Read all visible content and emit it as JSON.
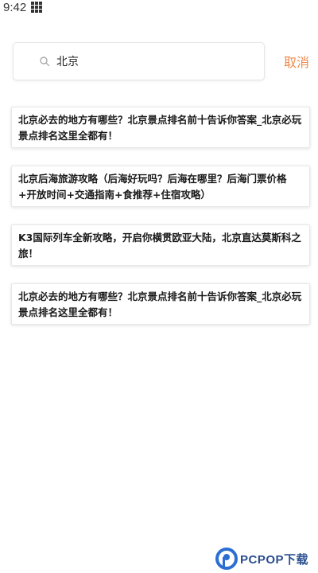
{
  "status_bar": {
    "time": "9:42",
    "icon": "app-grid-icon"
  },
  "search": {
    "query": "北京",
    "icon": "search-icon",
    "cancel_label": "取消"
  },
  "colors": {
    "accent": "#f08a4b",
    "watermark": "#2b4f8f"
  },
  "results": [
    {
      "title": "北京必去的地方有哪些？北京景点排名前十告诉你答案_北京必玩景点排名这里全都有！"
    },
    {
      "title": "北京后海旅游攻略（后海好玩吗？后海在哪里？后海门票价格+开放时间+交通指南+食推荐+住宿攻略）"
    },
    {
      "title": "K3国际列车全新攻略，开启你横贯欧亚大陆，北京直达莫斯科之旅！"
    },
    {
      "title": "北京必去的地方有哪些？北京景点排名前十告诉你答案_北京必玩景点排名这里全都有！"
    }
  ],
  "watermark": {
    "text": "PCPOP下载"
  }
}
